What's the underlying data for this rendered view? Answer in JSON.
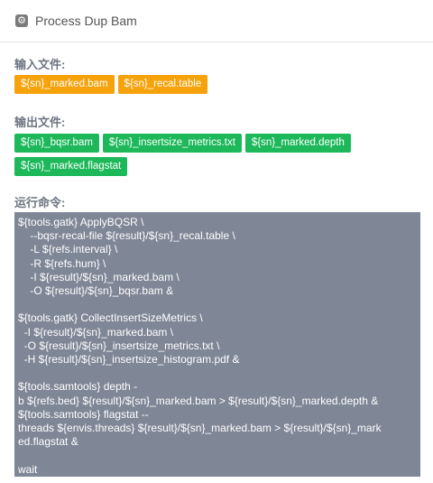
{
  "header": {
    "title": "Process Dup Bam",
    "icon": "gear-icon"
  },
  "inputs": {
    "label": "输入文件:",
    "files": [
      "${sn}_marked.bam",
      "${sn}_recal.table"
    ],
    "color": "#f5a20b"
  },
  "outputs": {
    "label": "输出文件:",
    "files": [
      "${sn}_bqsr.bam",
      "${sn}_insertsize_metrics.txt",
      "${sn}_marked.depth",
      "${sn}_marked.flagstat"
    ],
    "color": "#1db85a"
  },
  "command": {
    "label": "运行命令:",
    "lines": [
      "${tools.gatk} ApplyBQSR \\",
      "    --bqsr-recal-file ${result}/${sn}_recal.table \\",
      "    -L ${refs.interval} \\",
      "    -R ${refs.hum} \\",
      "    -I ${result}/${sn}_marked.bam \\",
      "    -O ${result}/${sn}_bqsr.bam &",
      "",
      "${tools.gatk} CollectInsertSizeMetrics \\",
      "  -I ${result}/${sn}_marked.bam \\",
      "  -O ${result}/${sn}_insertsize_metrics.txt \\",
      "  -H ${result}/${sn}_insertsize_histogram.pdf &",
      "",
      "${tools.samtools} depth -",
      "b ${refs.bed} ${result}/${sn}_marked.bam > ${result}/${sn}_marked.depth &",
      "${tools.samtools} flagstat --",
      "threads ${envis.threads} ${result}/${sn}_marked.bam > ${result}/${sn}_mark",
      "ed.flagstat &",
      "",
      "wait"
    ],
    "background": "#7f8696"
  }
}
